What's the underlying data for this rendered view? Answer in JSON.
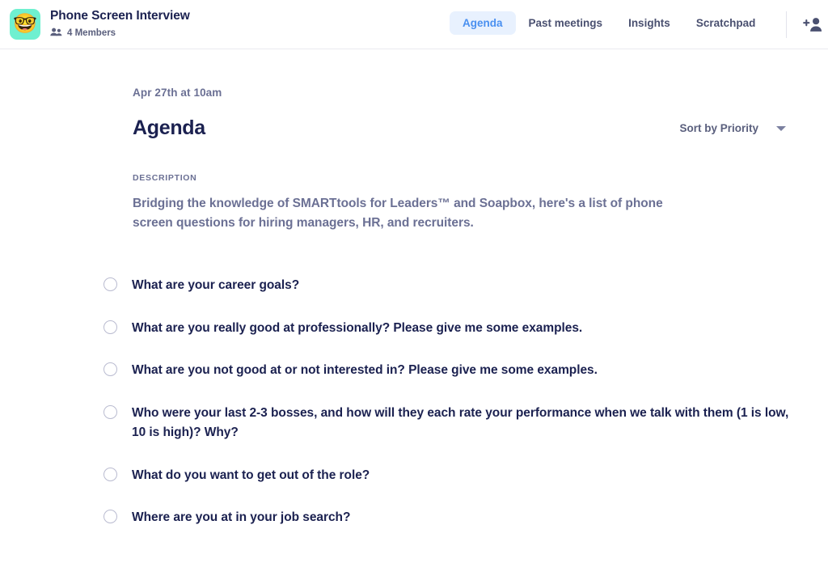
{
  "header": {
    "avatar_emoji": "🤓",
    "avatar_bg": "#6ff0d0",
    "workspace_title": "Phone Screen Interview",
    "members_label": "4 Members",
    "people_icon": "people-icon",
    "add_person_icon": "add-person-icon",
    "tabs": [
      {
        "label": "Agenda",
        "active": true
      },
      {
        "label": "Past meetings",
        "active": false
      },
      {
        "label": "Insights",
        "active": false
      },
      {
        "label": "Scratchpad",
        "active": false
      }
    ],
    "active_tab_bg": "#e8f1fe",
    "active_tab_color": "#4a90f0"
  },
  "main": {
    "meeting_date": "Apr 27th at 10am",
    "agenda_title": "Agenda",
    "sort": {
      "label": "Sort by Priority",
      "caret_icon": "chevron-down-icon"
    },
    "description_label": "DESCRIPTION",
    "description_body": "Bridging the knowledge of SMARTtools for Leaders™ and Soapbox, here's a list of phone screen questions for hiring managers, HR, and recruiters.",
    "items": [
      {
        "text": "What are your career goals?",
        "checked": false
      },
      {
        "text": "What are you really good at professionally? Please give me some examples.",
        "checked": false
      },
      {
        "text": "What are you not good at or not interested in? Please give me some examples.",
        "checked": false
      },
      {
        "text": "Who were your last 2-3 bosses, and how will they each rate your performance when we talk with them (1 is low, 10 is high)? Why?",
        "checked": false
      },
      {
        "text": "What do you want to get out of the role?",
        "checked": false
      },
      {
        "text": "Where are you at in your job search?",
        "checked": false
      }
    ]
  },
  "colors": {
    "text_dark": "#1b2150",
    "text_muted": "#6b7094",
    "accent_blue": "#4a90f0",
    "border": "#e9eaf0",
    "checkbox_border": "#b9bbd0"
  }
}
